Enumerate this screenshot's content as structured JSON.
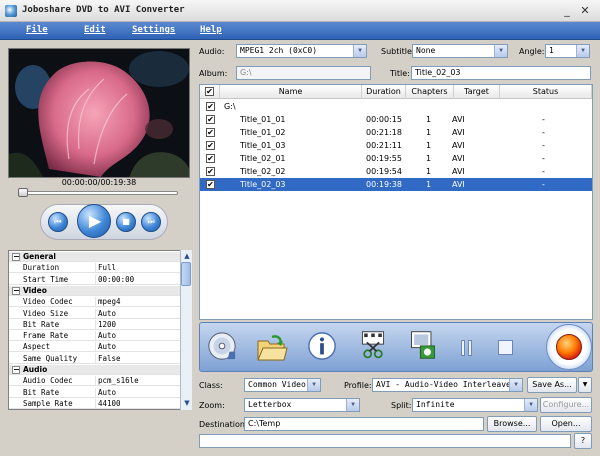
{
  "window": {
    "title": "Joboshare DVD to AVI Converter",
    "minimize_label": "_",
    "close_label": "✕"
  },
  "menu": [
    "File",
    "Edit",
    "Settings",
    "Help"
  ],
  "player": {
    "timecode": "00:00:00/00:19:38",
    "seek_fraction": 0.0
  },
  "properties": {
    "rows": [
      {
        "type": "category",
        "label": "General",
        "toggle": "−"
      },
      {
        "type": "item",
        "key": "Duration",
        "value": "Full"
      },
      {
        "type": "item",
        "key": "Start Time",
        "value": "00:00:00"
      },
      {
        "type": "category",
        "label": "Video",
        "toggle": "−"
      },
      {
        "type": "item",
        "key": "Video Codec",
        "value": "mpeg4"
      },
      {
        "type": "item",
        "key": "Video Size",
        "value": "Auto"
      },
      {
        "type": "item",
        "key": "Bit Rate",
        "value": "1200"
      },
      {
        "type": "item",
        "key": "Frame Rate",
        "value": "Auto"
      },
      {
        "type": "item",
        "key": "Aspect",
        "value": "Auto"
      },
      {
        "type": "item",
        "key": "Same Quality",
        "value": "False"
      },
      {
        "type": "category",
        "label": "Audio",
        "toggle": "−"
      },
      {
        "type": "item",
        "key": "Audio Codec",
        "value": "pcm_s16le"
      },
      {
        "type": "item",
        "key": "Bit Rate",
        "value": "Auto"
      },
      {
        "type": "item",
        "key": "Sample Rate",
        "value": "44100"
      }
    ]
  },
  "top_controls": {
    "audio_label": "Audio:",
    "audio_value": "MPEG1 2ch (0xC0)",
    "subtitle_label": "Subtitle:",
    "subtitle_value": "None",
    "angle_label": "Angle:",
    "angle_value": "1",
    "album_label": "Album:",
    "album_value": "G:\\",
    "title_label": "Title:",
    "title_value": "Title_02_03"
  },
  "title_list": {
    "columns": [
      "Name",
      "Duration",
      "Chapters",
      "Target",
      "Status"
    ],
    "root": "G:\\",
    "rows": [
      {
        "name": "Title_01_01",
        "duration": "00:00:15",
        "chapters": "1",
        "target": "AVI",
        "status": "-",
        "selected": false
      },
      {
        "name": "Title_01_02",
        "duration": "00:21:18",
        "chapters": "1",
        "target": "AVI",
        "status": "-",
        "selected": false
      },
      {
        "name": "Title_01_03",
        "duration": "00:21:11",
        "chapters": "1",
        "target": "AVI",
        "status": "-",
        "selected": false
      },
      {
        "name": "Title_02_01",
        "duration": "00:19:55",
        "chapters": "1",
        "target": "AVI",
        "status": "-",
        "selected": false
      },
      {
        "name": "Title_02_02",
        "duration": "00:19:54",
        "chapters": "1",
        "target": "AVI",
        "status": "-",
        "selected": false
      },
      {
        "name": "Title_02_03",
        "duration": "00:19:38",
        "chapters": "1",
        "target": "AVI",
        "status": "-",
        "selected": true
      }
    ]
  },
  "output": {
    "class_label": "Class:",
    "class_value": "Common Video",
    "profile_label": "Profile:",
    "profile_value": "AVI - Audio-Video Interleaved",
    "save_as_label": "Save As...",
    "zoom_label": "Zoom:",
    "zoom_value": "Letterbox",
    "split_label": "Split:",
    "split_value": "Infinite",
    "configure_label": "Configure...",
    "destination_label": "Destination:",
    "destination_value": "C:\\Temp",
    "browse_label": "Browse...",
    "open_label": "Open...",
    "help_label": "?"
  },
  "colors": {
    "menu_bar": "#2f62b5",
    "selection": "#316ac5",
    "record": "#ff7b00"
  }
}
